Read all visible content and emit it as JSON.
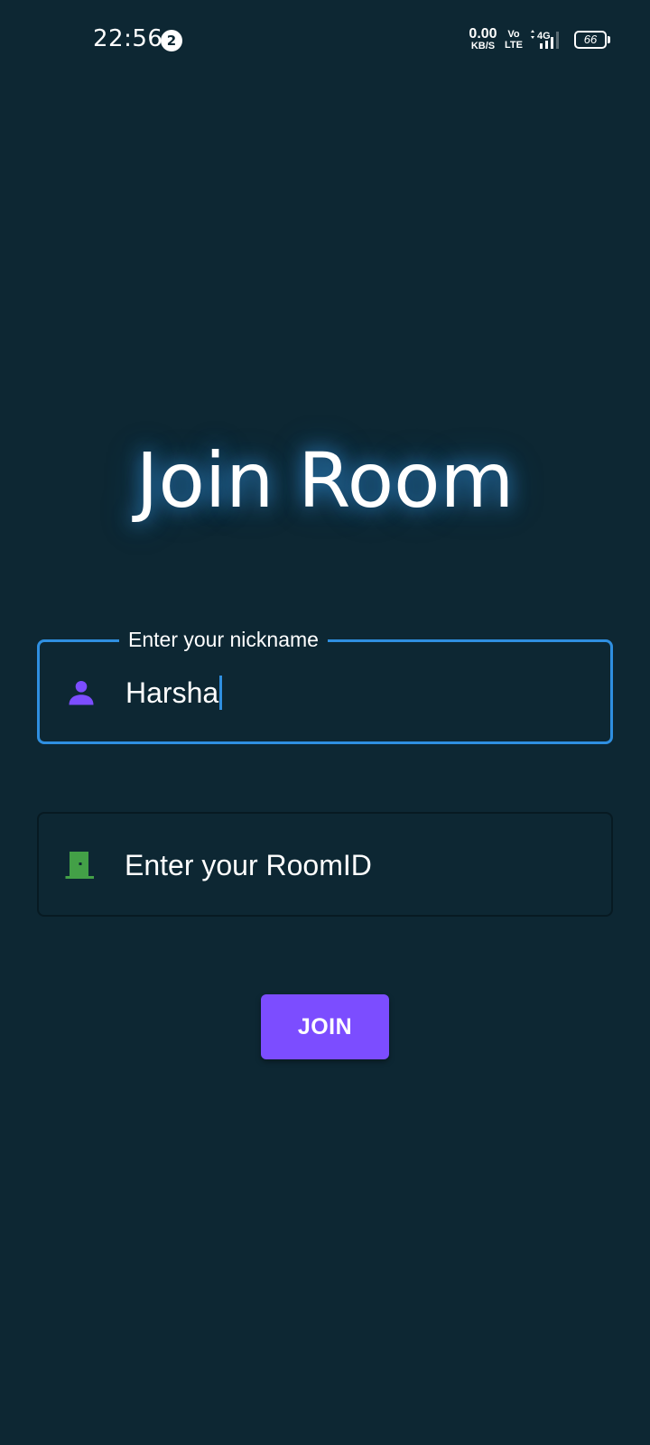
{
  "status_bar": {
    "time": "22:56",
    "notification_count": "2",
    "net_speed_value": "0.00",
    "net_speed_unit": "KB/S",
    "volte_top": "Vo",
    "volte_bottom": "LTE",
    "network_type": "4G",
    "battery_level": "66",
    "icons": [
      "notification-badge",
      "volte-icon",
      "signal-icon",
      "battery-icon"
    ]
  },
  "page": {
    "title": "Join Room"
  },
  "nickname_field": {
    "label": "Enter your nickname",
    "value": "Harsha",
    "icon": "person-icon",
    "focused": true
  },
  "roomid_field": {
    "placeholder": "Enter your RoomID",
    "value": "",
    "icon": "door-icon"
  },
  "join_button": {
    "label": "JOIN"
  },
  "colors": {
    "background": "#0d2733",
    "accent_blue": "#2f8fe0",
    "button_purple": "#7c4dff",
    "person_icon": "#7c4dff",
    "door_icon": "#43a047",
    "text": "#ffffff"
  }
}
